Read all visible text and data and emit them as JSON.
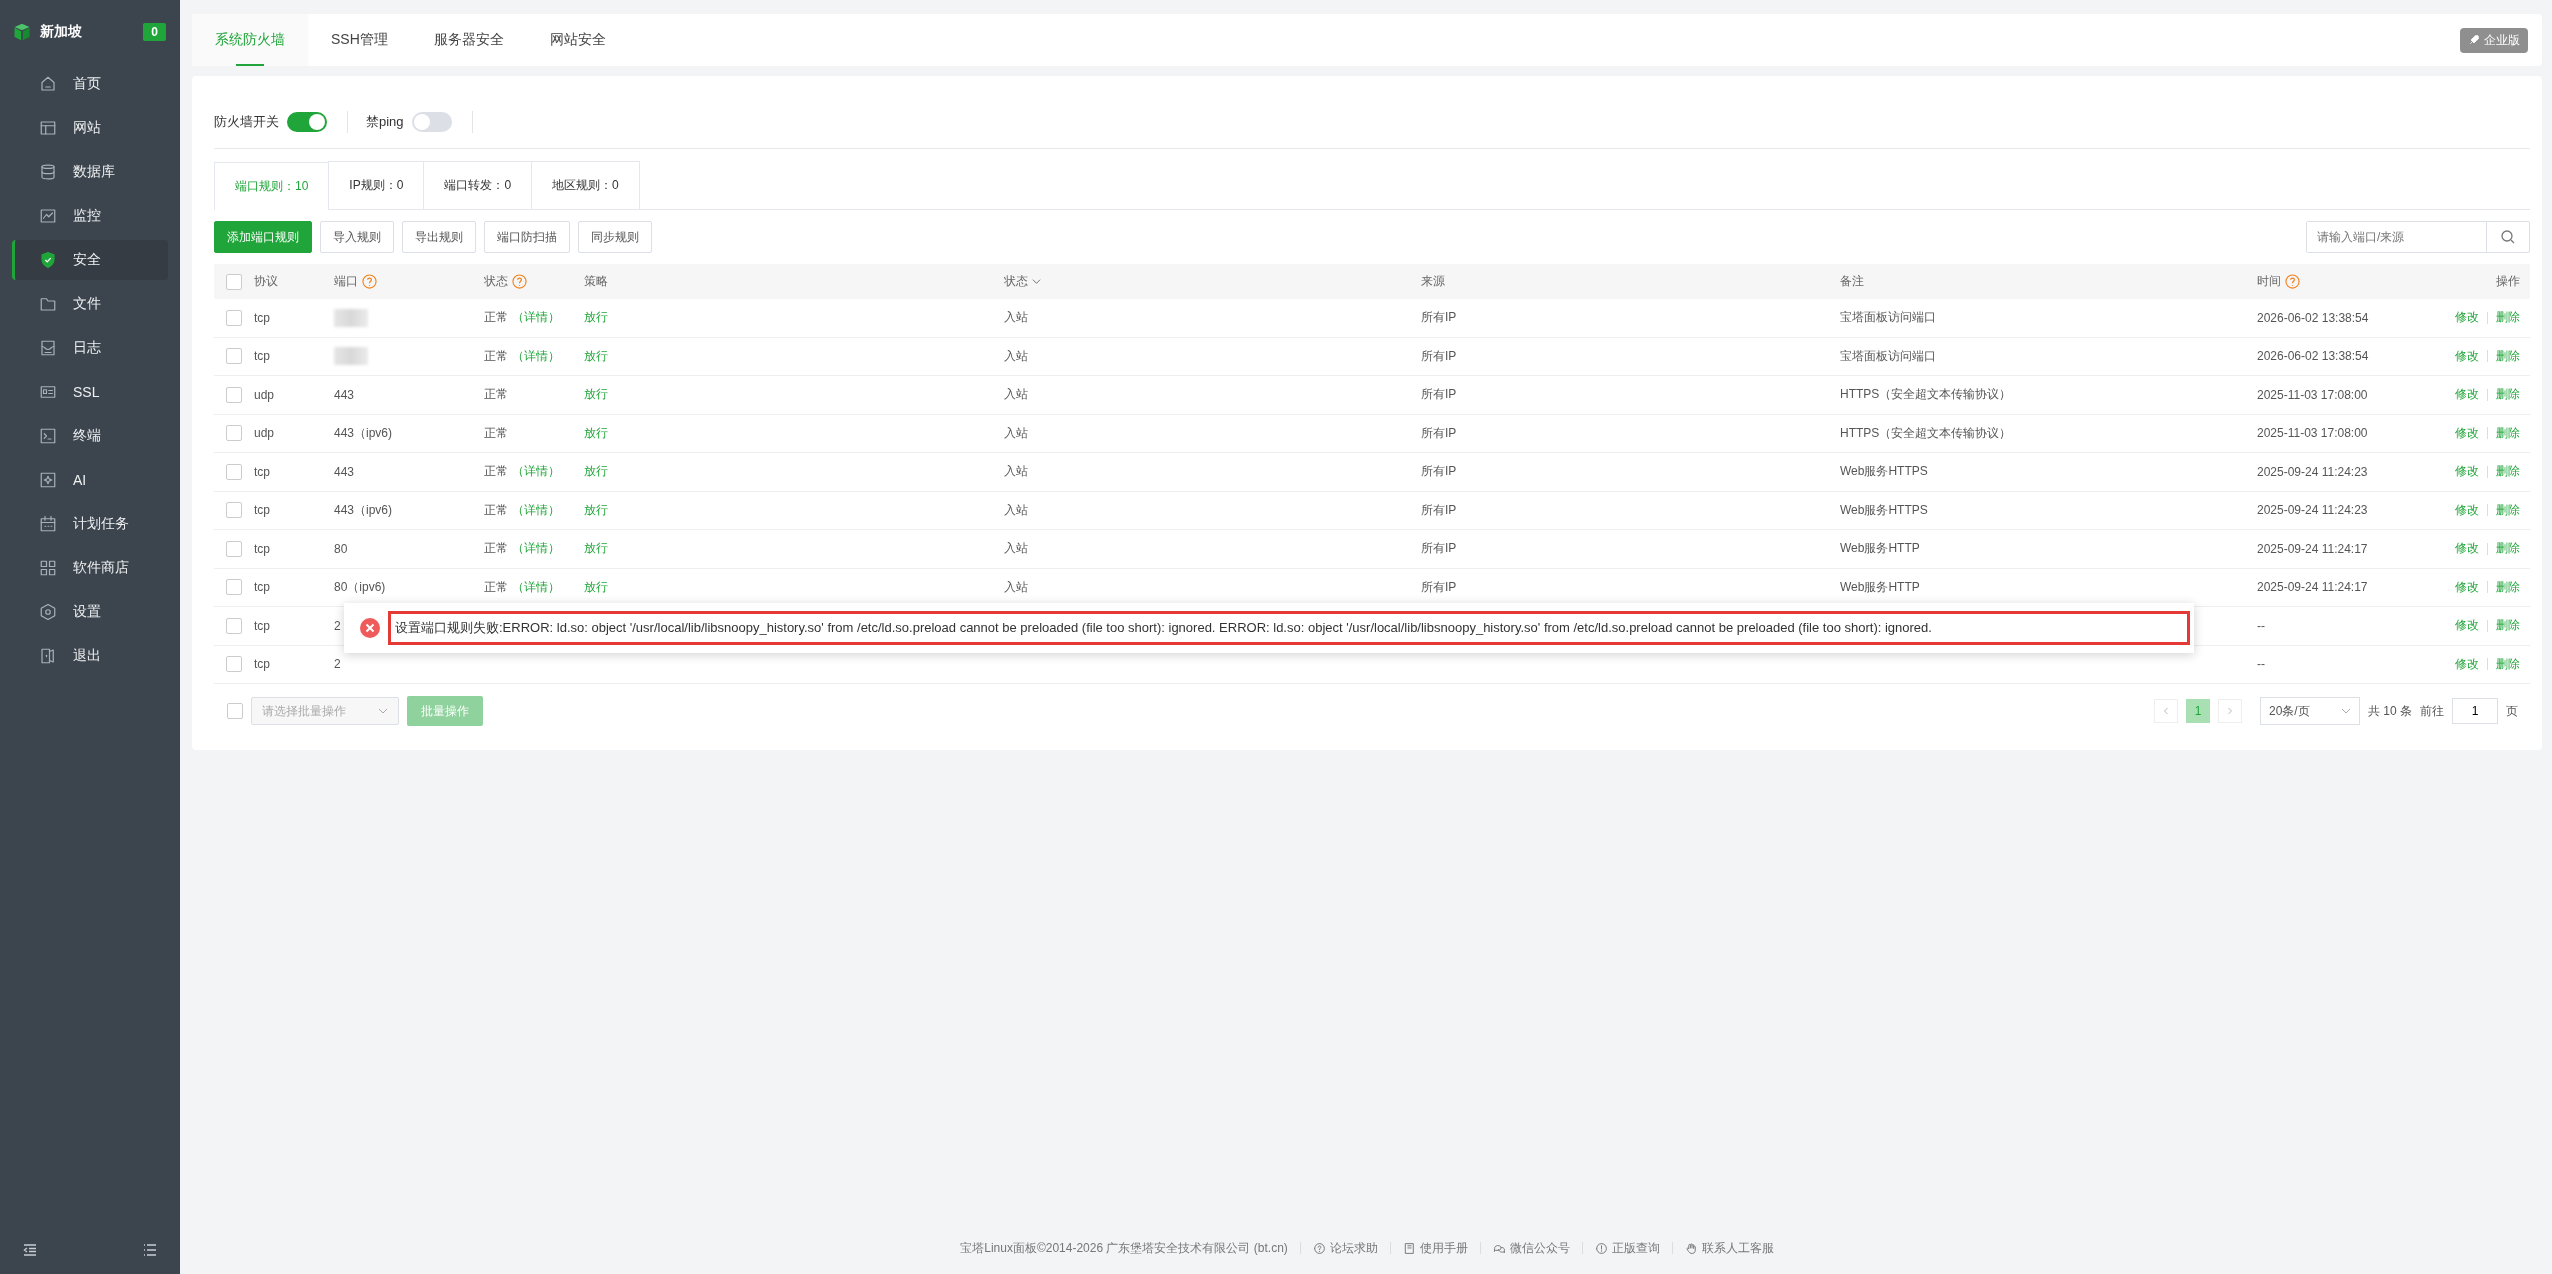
{
  "sidebar": {
    "title": "新加坡",
    "badge": "0",
    "items": [
      {
        "label": "首页",
        "selected": false
      },
      {
        "label": "网站",
        "selected": false
      },
      {
        "label": "数据库",
        "selected": false
      },
      {
        "label": "监控",
        "selected": false
      },
      {
        "label": "安全",
        "selected": true
      },
      {
        "label": "文件",
        "selected": false
      },
      {
        "label": "日志",
        "selected": false
      },
      {
        "label": "SSL",
        "selected": false
      },
      {
        "label": "终端",
        "selected": false
      },
      {
        "label": "AI",
        "selected": false
      },
      {
        "label": "计划任务",
        "selected": false
      },
      {
        "label": "软件商店",
        "selected": false
      },
      {
        "label": "设置",
        "selected": false
      },
      {
        "label": "退出",
        "selected": false
      }
    ]
  },
  "tabs": [
    {
      "label": "系统防火墙",
      "selected": true
    },
    {
      "label": "SSH管理",
      "selected": false
    },
    {
      "label": "服务器安全",
      "selected": false
    },
    {
      "label": "网站安全",
      "selected": false
    }
  ],
  "edition_button": "企业版",
  "switches": [
    {
      "label": "防火墙开关",
      "on": true
    },
    {
      "label": "禁ping",
      "on": false
    }
  ],
  "rule_tabs": [
    {
      "label": "端口规则：10",
      "selected": true
    },
    {
      "label": "IP规则：0",
      "selected": false
    },
    {
      "label": "端口转发：0",
      "selected": false
    },
    {
      "label": "地区规则：0",
      "selected": false
    }
  ],
  "toolbar_buttons": [
    {
      "label": "添加端口规则",
      "primary": true
    },
    {
      "label": "导入规则",
      "primary": false
    },
    {
      "label": "导出规则",
      "primary": false
    },
    {
      "label": "端口防扫描",
      "primary": false
    },
    {
      "label": "同步规则",
      "primary": false
    }
  ],
  "search": {
    "placeholder": "请输入端口/来源"
  },
  "table": {
    "select_all_checked": false,
    "columns": [
      {
        "label": "协议",
        "kind": "plain"
      },
      {
        "label": "端口",
        "kind": "help"
      },
      {
        "label": "状态",
        "kind": "help"
      },
      {
        "label": "策略",
        "kind": "plain"
      },
      {
        "label": "状态",
        "kind": "sort"
      },
      {
        "label": "来源",
        "kind": "plain"
      },
      {
        "label": "备注",
        "kind": "plain"
      },
      {
        "label": "时间",
        "kind": "help"
      },
      {
        "label": "操作",
        "kind": "plain"
      }
    ],
    "rows": [
      {
        "checked": false,
        "protocol": "tcp",
        "port_blurred": true,
        "status": "正常",
        "detail": "（详情）",
        "policy": "放行",
        "direction": "入站",
        "source": "所有IP",
        "note": "宝塔面板访问端口",
        "time": "2026-06-02 13:38:54",
        "actions": [
          "修改",
          "删除"
        ]
      },
      {
        "checked": false,
        "protocol": "tcp",
        "port_blurred": true,
        "status": "正常",
        "detail": "（详情）",
        "policy": "放行",
        "direction": "入站",
        "source": "所有IP",
        "note": "宝塔面板访问端口",
        "time": "2026-06-02 13:38:54",
        "actions": [
          "修改",
          "删除"
        ]
      },
      {
        "checked": false,
        "protocol": "udp",
        "port": "443",
        "status": "正常",
        "policy": "放行",
        "direction": "入站",
        "source": "所有IP",
        "note": "HTTPS（安全超文本传输协议）",
        "time": "2025-11-03 17:08:00",
        "actions": [
          "修改",
          "删除"
        ]
      },
      {
        "checked": false,
        "protocol": "udp",
        "port": "443（ipv6)",
        "status": "正常",
        "policy": "放行",
        "direction": "入站",
        "source": "所有IP",
        "note": "HTTPS（安全超文本传输协议）",
        "time": "2025-11-03 17:08:00",
        "actions": [
          "修改",
          "删除"
        ]
      },
      {
        "checked": false,
        "protocol": "tcp",
        "port": "443",
        "status": "正常",
        "detail": "（详情）",
        "policy": "放行",
        "direction": "入站",
        "source": "所有IP",
        "note": "Web服务HTTPS",
        "time": "2025-09-24 11:24:23",
        "actions": [
          "修改",
          "删除"
        ]
      },
      {
        "checked": false,
        "protocol": "tcp",
        "port": "443（ipv6)",
        "status": "正常",
        "detail": "（详情）",
        "policy": "放行",
        "direction": "入站",
        "source": "所有IP",
        "note": "Web服务HTTPS",
        "time": "2025-09-24 11:24:23",
        "actions": [
          "修改",
          "删除"
        ]
      },
      {
        "checked": false,
        "protocol": "tcp",
        "port": "80",
        "status": "正常",
        "detail": "（详情）",
        "policy": "放行",
        "direction": "入站",
        "source": "所有IP",
        "note": "Web服务HTTP",
        "time": "2025-09-24 11:24:17",
        "actions": [
          "修改",
          "删除"
        ]
      },
      {
        "checked": false,
        "protocol": "tcp",
        "port": "80（ipv6)",
        "status": "正常",
        "detail": "（详情）",
        "policy": "放行",
        "direction": "入站",
        "source": "所有IP",
        "note": "Web服务HTTP",
        "time": "2025-09-24 11:24:17",
        "actions": [
          "修改",
          "删除"
        ]
      },
      {
        "checked": false,
        "protocol": "tcp",
        "port": "2",
        "time": "--",
        "actions": [
          "修改",
          "删除"
        ]
      },
      {
        "checked": false,
        "protocol": "tcp",
        "port": "2",
        "time": "--",
        "actions": [
          "修改",
          "删除"
        ]
      }
    ]
  },
  "batch": {
    "select_all_checked": false,
    "placeholder": "请选择批量操作",
    "button": "批量操作",
    "disabled": true
  },
  "pagination": {
    "pages": [
      {
        "label": "1",
        "selected": true
      }
    ],
    "page_size": "20条/页",
    "total": "共 10 条",
    "goto_label": "前往",
    "goto_value": "1",
    "goto_suffix": "页"
  },
  "toast": {
    "message": "设置端口规则失败:ERROR: ld.so: object '/usr/local/lib/libsnoopy_history.so' from /etc/ld.so.preload cannot be preloaded (file too short): ignored. ERROR: ld.so: object '/usr/local/lib/libsnoopy_history.so' from /etc/ld.so.preload cannot be preloaded (file too short): ignored."
  },
  "footer": {
    "copyright": "宝塔Linux面板©2014-2026 广东堡塔安全技术有限公司 (bt.cn)",
    "links": [
      {
        "label": "论坛求助"
      },
      {
        "label": "使用手册"
      },
      {
        "label": "微信公众号"
      },
      {
        "label": "正版查询"
      },
      {
        "label": "联系人工客服"
      }
    ]
  }
}
